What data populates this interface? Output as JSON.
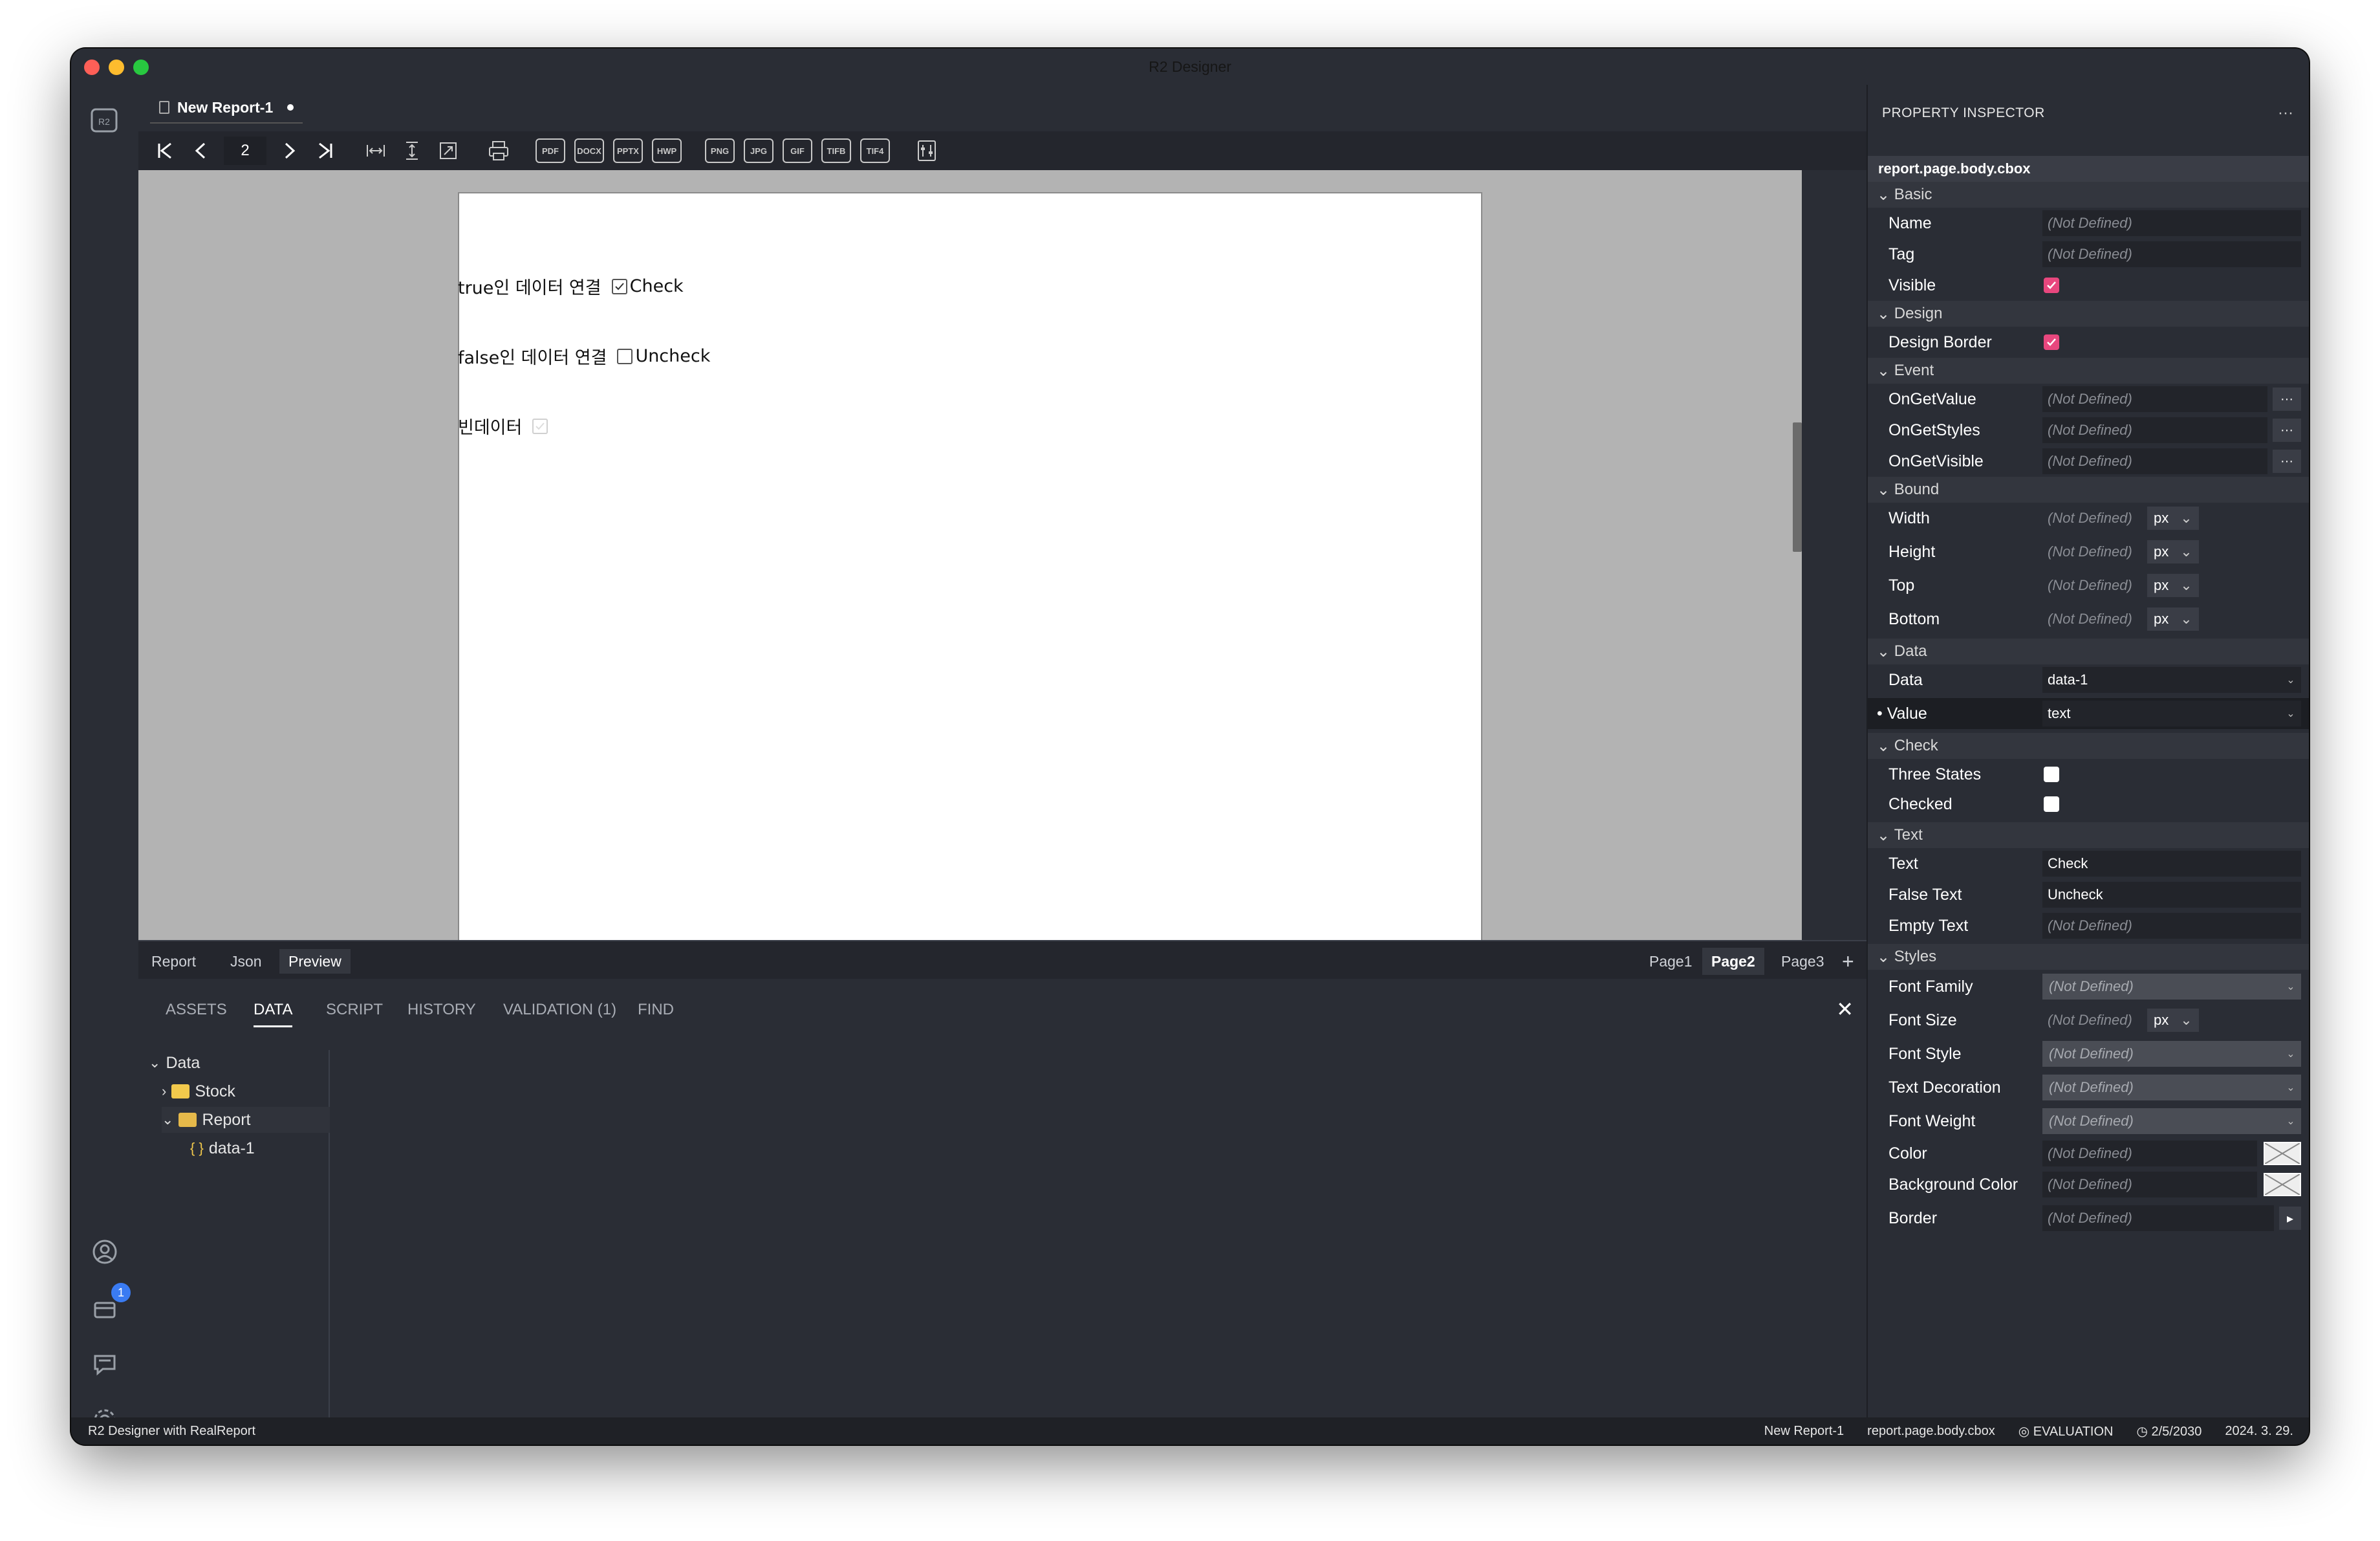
{
  "window": {
    "title": "R2 Designer"
  },
  "editor": {
    "tab_label": "New Report-1",
    "current_page": "2"
  },
  "preview": {
    "rows": [
      {
        "label": "true인 데이터 연결",
        "text": "Check"
      },
      {
        "label": "false인 데이터 연결",
        "text": "Uncheck"
      },
      {
        "label": "빈데이터",
        "text": ""
      }
    ]
  },
  "view_tabs": [
    "Report",
    "Json",
    "Preview"
  ],
  "page_tabs": [
    "Page1",
    "Page2",
    "Page3"
  ],
  "panel": {
    "tabs": [
      "ASSETS",
      "DATA",
      "SCRIPT",
      "HISTORY",
      "VALIDATION (1)",
      "FIND"
    ],
    "tree": {
      "root": "Data",
      "stock": "Stock",
      "report": "Report",
      "data1": "data-1"
    }
  },
  "inspector": {
    "title": "PROPERTY INSPECTOR",
    "path": "report.page.body.cbox",
    "not_defined": "(Not Defined)",
    "unit": "px",
    "sections": {
      "basic": "Basic",
      "design": "Design",
      "event": "Event",
      "bound": "Bound",
      "data": "Data",
      "check": "Check",
      "text": "Text",
      "styles": "Styles"
    },
    "props": {
      "name": "Name",
      "tag": "Tag",
      "visible": "Visible",
      "design_border": "Design Border",
      "on_get_value": "OnGetValue",
      "on_get_styles": "OnGetStyles",
      "on_get_visible": "OnGetVisible",
      "width": "Width",
      "height": "Height",
      "top": "Top",
      "bottom": "Bottom",
      "data": "Data",
      "data_value": "data-1",
      "value": "Value",
      "value_value": "text",
      "three_states": "Three States",
      "checked": "Checked",
      "text": "Text",
      "text_value": "Check",
      "false_text": "False Text",
      "false_text_value": "Uncheck",
      "empty_text": "Empty Text",
      "font_family": "Font Family",
      "font_size": "Font Size",
      "font_style": "Font Style",
      "text_decoration": "Text Decoration",
      "font_weight": "Font Weight",
      "color": "Color",
      "background_color": "Background Color",
      "border": "Border"
    }
  },
  "status": {
    "left": "R2 Designer with RealReport",
    "report": "New Report-1",
    "path": "report.page.body.cbox",
    "license": "EVALUATION",
    "expiry": "2/5/2030",
    "date": "2024. 3. 29."
  },
  "badges": {
    "notifications": "1"
  },
  "colors": {
    "accent_checkbox": "#e8477e",
    "badge": "#3a7bf2"
  }
}
